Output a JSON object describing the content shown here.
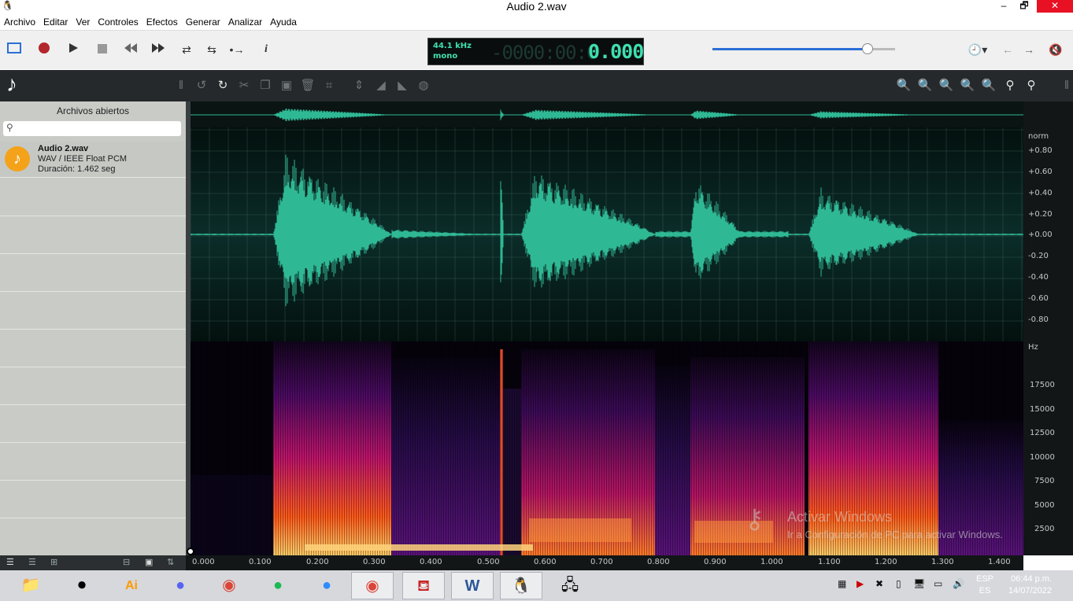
{
  "window": {
    "title": "Audio 2.wav",
    "minimize": "–",
    "maximize": "🗗",
    "close": "✕",
    "app_icon": "penguin-icon"
  },
  "menu": [
    "Archivo",
    "Editar",
    "Ver",
    "Controles",
    "Efectos",
    "Generar",
    "Analizar",
    "Ayuda"
  ],
  "transport": {
    "sample_rate": "44.1 kHz",
    "channels": "mono",
    "time_ghost": "-0000:00:0",
    "time": "0.000",
    "volume": 0.85
  },
  "sidebar": {
    "title": "Archivos abiertos",
    "search_placeholder": "",
    "files": [
      {
        "name": "Audio 2.wav",
        "format": "WAV / IEEE Float PCM",
        "duration": "Duración: 1.462 seg"
      }
    ]
  },
  "amplitude_axis": [
    "norm",
    "+0.80",
    "+0.60",
    "+0.40",
    "+0.20",
    "+0.00",
    "-0.20",
    "-0.40",
    "-0.60",
    "-0.80"
  ],
  "frequency_axis": [
    "Hz",
    "17500",
    "15000",
    "12500",
    "10000",
    "7500",
    "5000",
    "2500"
  ],
  "time_axis": [
    "0.000",
    "0.100",
    "0.200",
    "0.300",
    "0.400",
    "0.500",
    "0.600",
    "0.700",
    "0.800",
    "0.900",
    "1.000",
    "1.100",
    "1.200",
    "1.300",
    "1.400"
  ],
  "watermark": {
    "line1": "Activar Windows",
    "line2": "Ir a Configuración de PC para activar Windows."
  },
  "taskbar": {
    "apps": [
      "file-explorer-icon",
      "obs-icon",
      "illustrator-icon",
      "discord-icon",
      "chrome-icon",
      "spotify-icon",
      "zoom-icon",
      "chrome-icon",
      "acrobat-icon",
      "word-icon",
      "audio-editor-icon",
      "network-icon"
    ],
    "lang_top": "ESP",
    "lang_bottom": "ES",
    "time": "06:44 p.m.",
    "date": "14/07/2022"
  },
  "colors": {
    "waveform": "#2fb894",
    "lcd_text": "#3ee0b0",
    "accent": "#2b6fd6"
  }
}
